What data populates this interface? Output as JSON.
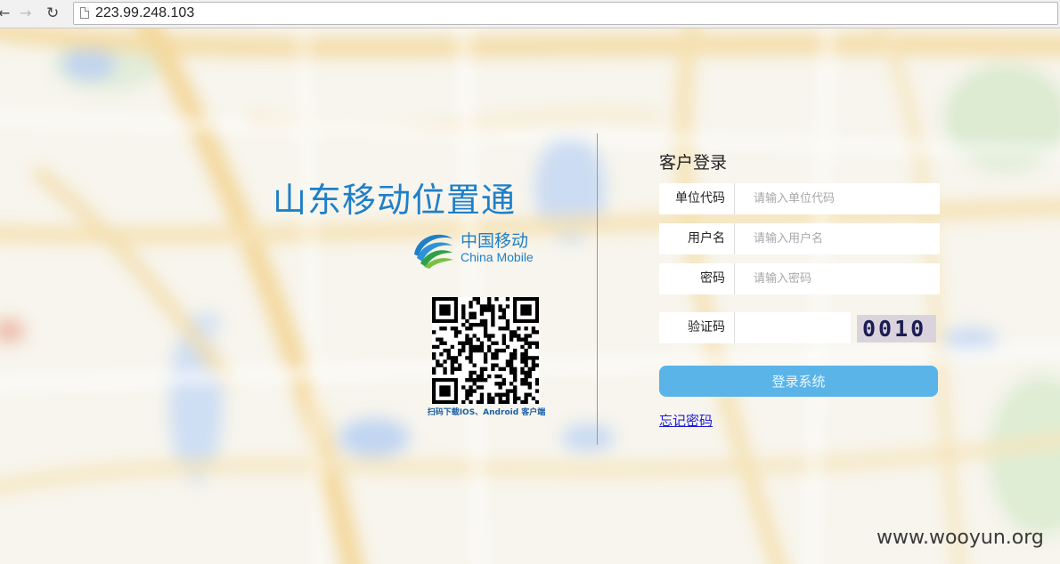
{
  "browser": {
    "url": "223.99.248.103",
    "back_icon": "←",
    "forward_icon": "→",
    "reload_icon": "↻"
  },
  "branding": {
    "title": "山东移动位置通",
    "logo_cn": "中国移动",
    "logo_en": "China Mobile",
    "qr_caption": "扫码下载IOS、Android 客户端"
  },
  "login": {
    "title": "客户登录",
    "fields": [
      {
        "label": "单位代码",
        "placeholder": "请输入单位代码",
        "value": ""
      },
      {
        "label": "用户名",
        "placeholder": "请输入用户名",
        "value": ""
      },
      {
        "label": "密码",
        "placeholder": "请输入密码",
        "value": ""
      },
      {
        "label": "验证码",
        "placeholder": "",
        "value": ""
      }
    ],
    "captcha_text": "0010",
    "submit_label": "登录系统",
    "forgot_label": "忘记密码"
  },
  "watermark": "www.wooyun.org",
  "colors": {
    "brand_blue": "#1f7fc8",
    "button_blue": "#5ab4e8",
    "link_blue": "#1a1ad8"
  }
}
